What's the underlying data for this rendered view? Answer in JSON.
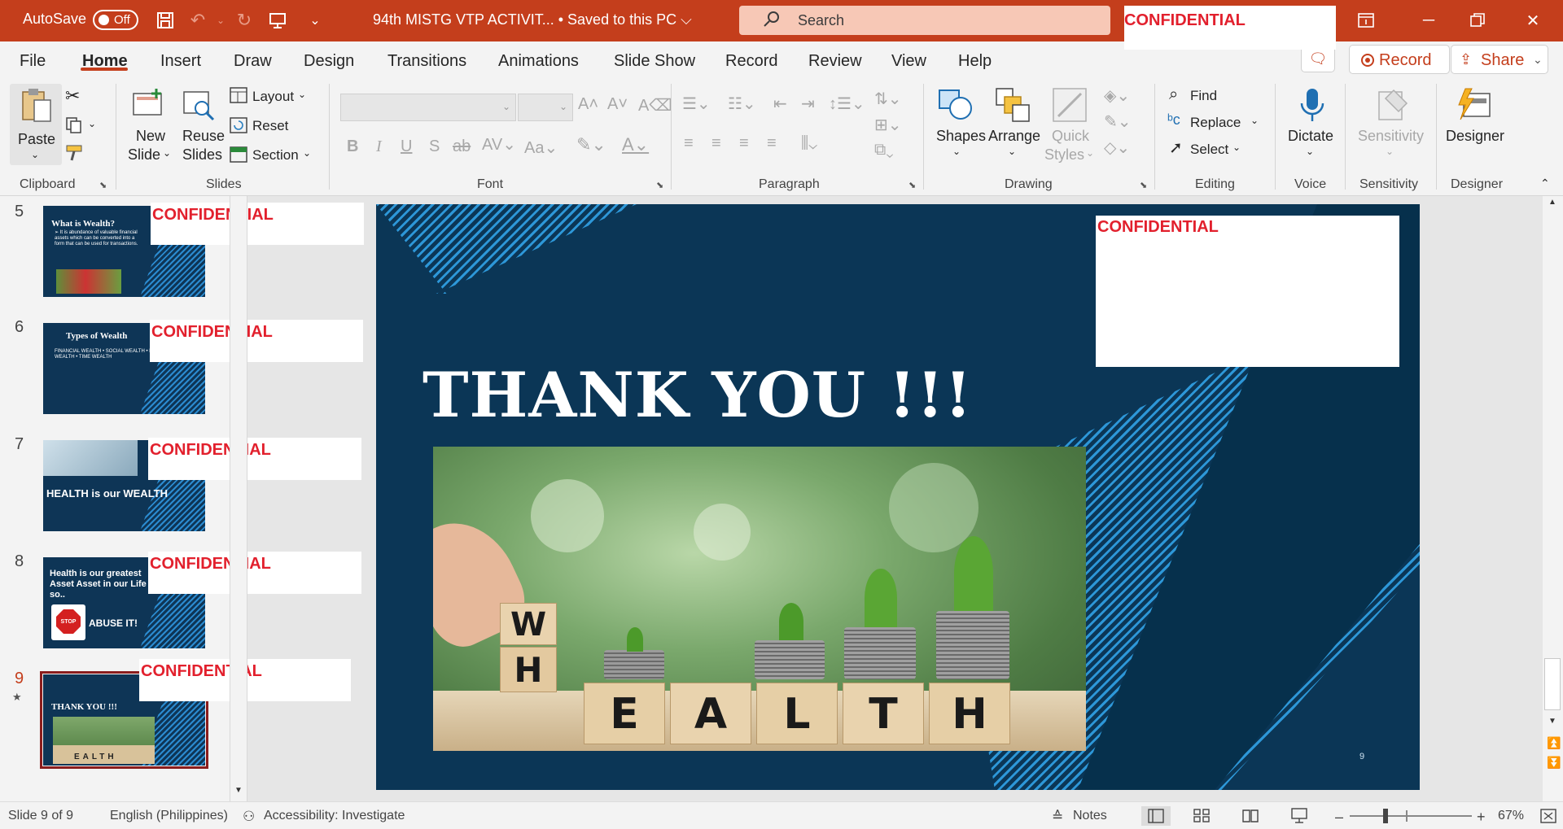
{
  "titlebar": {
    "autosave_label": "AutoSave",
    "autosave_state": "Off",
    "doc_title": "94th  MISTG VTP  ACTIVIT...  • Saved to this PC ⌵",
    "search_placeholder": "Search",
    "confidential": "CONFIDENTIAL"
  },
  "tabs": [
    "File",
    "Home",
    "Insert",
    "Draw",
    "Design",
    "Transitions",
    "Animations",
    "Slide Show",
    "Record",
    "Review",
    "View",
    "Help"
  ],
  "active_tab": "Home",
  "actions": {
    "record": "Record",
    "share": "Share"
  },
  "ribbon": {
    "clipboard": {
      "paste": "Paste",
      "label": "Clipboard"
    },
    "slides": {
      "new_slide_1": "New",
      "new_slide_2": "Slide",
      "reuse_1": "Reuse",
      "reuse_2": "Slides",
      "layout": "Layout",
      "reset": "Reset",
      "section": "Section",
      "label": "Slides"
    },
    "font": {
      "label": "Font"
    },
    "paragraph": {
      "label": "Paragraph"
    },
    "drawing": {
      "shapes": "Shapes",
      "arrange": "Arrange",
      "quick_1": "Quick",
      "quick_2": "Styles",
      "label": "Drawing"
    },
    "editing": {
      "find": "Find",
      "replace": "Replace",
      "select": "Select",
      "label": "Editing"
    },
    "voice": {
      "dictate": "Dictate",
      "label": "Voice"
    },
    "sensitivity": {
      "sensitivity": "Sensitivity",
      "label": "Sensitivity"
    },
    "designer": {
      "designer": "Designer",
      "label": "Designer"
    }
  },
  "thumbnails": [
    {
      "num": "5",
      "title": "What is Wealth?",
      "body": "➢ It is abundance of valuable financial assets which can be converted into a form that can be used for transactions.",
      "confidential": "CONFIDENTIAL"
    },
    {
      "num": "6",
      "title": "Types of Wealth",
      "body": "FINANCIAL WEALTH • SOCIAL WEALTH • PHYSICAL WEALTH • TIME WEALTH",
      "confidential": "CONFIDENTIAL"
    },
    {
      "num": "7",
      "title": "HEALTH is our WEALTH",
      "confidential": "CONFIDENTIAL"
    },
    {
      "num": "8",
      "title": "Health is our greatest Asset Asset in our Life so..",
      "body": "ABUSE IT!",
      "stop": "STOP",
      "confidential": "CONFIDENTIAL"
    },
    {
      "num": "9",
      "title": "THANK YOU !!!",
      "body": "EALTH",
      "confidential": "CONFIDENTIAL"
    }
  ],
  "slide": {
    "title": "THANK YOU !!!",
    "blocks": [
      "W",
      "H",
      "E",
      "A",
      "L",
      "T",
      "H"
    ],
    "slide_number": "9",
    "confidential": "CONFIDENTIAL"
  },
  "statusbar": {
    "slide_info": "Slide 9 of 9",
    "language": "English (Philippines)",
    "accessibility": "Accessibility: Investigate",
    "notes": "Notes",
    "zoom_minus": "–",
    "zoom_plus": "+",
    "zoom": "67%"
  },
  "colors": {
    "accent": "#c43e1c",
    "confidential": "#e2202d",
    "slide_bg": "#0b3656",
    "stripe": "#2d97d8"
  }
}
